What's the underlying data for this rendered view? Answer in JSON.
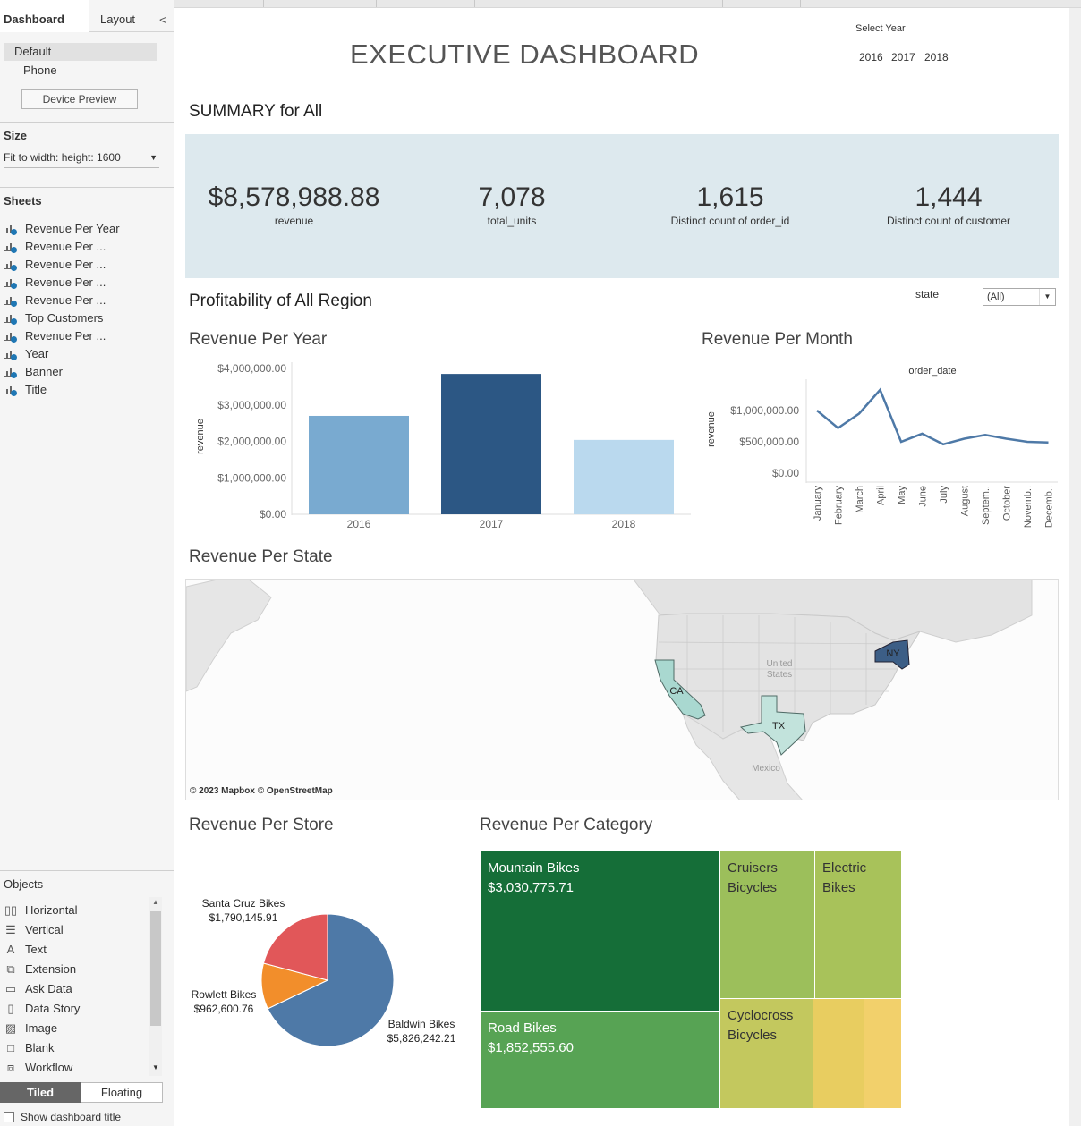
{
  "left_panel": {
    "tabs": {
      "dashboard": "Dashboard",
      "layout": "Layout",
      "collapse_icon": "<"
    },
    "device": {
      "default": "Default",
      "phone": "Phone",
      "preview_button": "Device Preview"
    },
    "size": {
      "title": "Size",
      "value": "Fit to width: height: 1600",
      "arrow": "▼"
    },
    "sheets": {
      "title": "Sheets",
      "items": [
        "Revenue Per Year",
        "Revenue Per ...",
        "Revenue Per ...",
        "Revenue Per ...",
        "Revenue Per ...",
        "Top Customers",
        "Revenue Per ...",
        "Year",
        "Banner",
        "Title"
      ]
    },
    "objects": {
      "title": "Objects",
      "items": [
        {
          "label": "Horizontal",
          "icon": "▯▯",
          "icon_name": "horizontal-container-icon"
        },
        {
          "label": "Vertical",
          "icon": "☰",
          "icon_name": "vertical-container-icon"
        },
        {
          "label": "Text",
          "icon": "A",
          "icon_name": "text-icon"
        },
        {
          "label": "Extension",
          "icon": "⧉",
          "icon_name": "extension-icon"
        },
        {
          "label": "Ask Data",
          "icon": "▭",
          "icon_name": "ask-data-icon"
        },
        {
          "label": "Data Story",
          "icon": "▯",
          "icon_name": "data-story-icon"
        },
        {
          "label": "Image",
          "icon": "▨",
          "icon_name": "image-icon"
        },
        {
          "label": "Blank",
          "icon": "□",
          "icon_name": "blank-icon"
        },
        {
          "label": "Workflow",
          "icon": "⧈",
          "icon_name": "workflow-icon"
        }
      ]
    },
    "layout_toggle": {
      "tiled": "Tiled",
      "floating": "Floating"
    },
    "show_title": "Show dashboard title"
  },
  "dashboard": {
    "title": "EXECUTIVE DASHBOARD",
    "select_year": {
      "label": "Select Year",
      "years": [
        "2016",
        "2017",
        "2018"
      ]
    },
    "summary": {
      "title": "SUMMARY for  All",
      "kpis": [
        {
          "value": "$8,578,988.88",
          "label": "revenue"
        },
        {
          "value": "7,078",
          "label": "total_units"
        },
        {
          "value": "1,615",
          "label": "Distinct count of order_id"
        },
        {
          "value": "1,444",
          "label": "Distinct count of customer"
        }
      ],
      "colors": {
        "background": "#dde9ee"
      }
    },
    "profitability_title": "Profitability of All Region",
    "state_filter": {
      "label": "state",
      "value": "(All)",
      "arrow": "▼"
    },
    "map": {
      "title": "Revenue Per State",
      "labels": {
        "united_states": "United\nStates",
        "mexico": "Mexico"
      },
      "credit": "© 2023 Mapbox © OpenStreetMap"
    }
  },
  "chart_data": [
    {
      "type": "bar",
      "title": "Revenue Per Year",
      "categories": [
        "2016",
        "2017",
        "2018"
      ],
      "values": [
        2700000,
        3850000,
        2040000
      ],
      "ylabel": "revenue",
      "ylim": [
        0,
        4000000
      ],
      "y_ticks": [
        "$0.00",
        "$1,000,000.00",
        "$2,000,000.00",
        "$3,000,000.00",
        "$4,000,000.00"
      ],
      "y_tick_values": [
        0,
        1000000,
        2000000,
        3000000,
        4000000
      ],
      "colors": [
        "#79aad0",
        "#2c5784",
        "#bad9ee"
      ],
      "grid": false
    },
    {
      "type": "line",
      "title": "Revenue Per Month",
      "header": "order_date",
      "categories": [
        "January",
        "February",
        "March",
        "April",
        "May",
        "June",
        "July",
        "August",
        "Septem..",
        "October",
        "Novemb..",
        "Decemb.."
      ],
      "values": [
        1000000,
        720000,
        950000,
        1330000,
        500000,
        630000,
        460000,
        550000,
        610000,
        550000,
        500000,
        490000
      ],
      "ylabel": "revenue",
      "ylim": [
        0,
        1500000
      ],
      "y_ticks": [
        "$0.00",
        "$500,000.00",
        "$1,000,000.00"
      ],
      "y_tick_values": [
        0,
        500000,
        1000000
      ],
      "color": "#4e79a7"
    },
    {
      "type": "pie",
      "title": "Revenue Per Store",
      "slices": [
        {
          "label": "Baldwin Bikes",
          "value": 5826242.21,
          "value_label": "$5,826,242.21",
          "color": "#4e79a7"
        },
        {
          "label": "Rowlett Bikes",
          "value": 962600.76,
          "value_label": "$962,600.76",
          "color": "#f28e2b"
        },
        {
          "label": "Santa Cruz Bikes",
          "value": 1790145.91,
          "value_label": "$1,790,145.91",
          "color": "#e15759"
        }
      ]
    },
    {
      "type": "treemap",
      "title": "Revenue Per Category",
      "items": [
        {
          "label": "Mountain Bikes",
          "value_label": "$3,030,775.71",
          "color": "#156e38"
        },
        {
          "label": "Road Bikes",
          "value_label": "$1,852,555.60",
          "color": "#57a354"
        },
        {
          "label": "Cruisers Bicycles",
          "value_label": "",
          "color": "#9cbf5b"
        },
        {
          "label": "Electric Bikes",
          "value_label": "",
          "color": "#a8c25a"
        },
        {
          "label": "Cyclocross Bicycles",
          "value_label": "",
          "color": "#c3c85e"
        },
        {
          "label": "",
          "value_label": "",
          "color": "#e8cd60"
        },
        {
          "label": "",
          "value_label": "",
          "color": "#f2d06b"
        }
      ]
    }
  ]
}
